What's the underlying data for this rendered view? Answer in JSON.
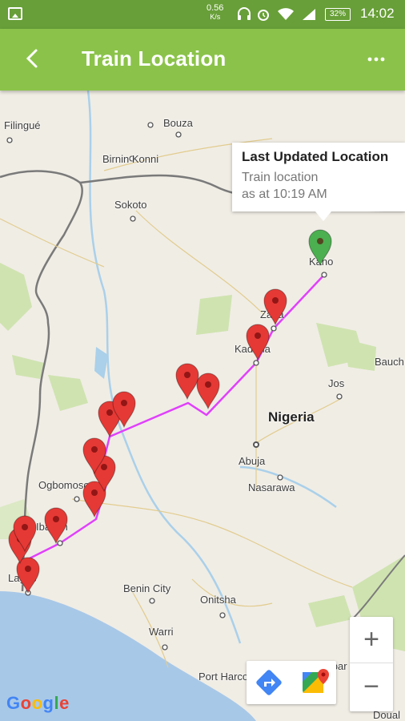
{
  "status_bar": {
    "net_speed": "0.56",
    "net_unit": "K/s",
    "battery": "32%",
    "time": "14:02"
  },
  "app_bar": {
    "title": "Train Location"
  },
  "map": {
    "places": {
      "filingue": "Filingué",
      "bouza": "Bouza",
      "birnin_konni": "Birnin Konni",
      "sokoto": "Sokoto",
      "kano": "Kano",
      "zaria": "Zaria",
      "kaduna": "Kaduna",
      "bauchi": "Bauch",
      "jos": "Jos",
      "nigeria": "Nigeria",
      "abuja": "Abuja",
      "nasarawa": "Nasarawa",
      "ogbomoso": "Ogbomoso",
      "ibadan": "Ibadan",
      "lagos": "Lagos",
      "benin_city": "Benin City",
      "onitsha": "Onitsha",
      "warri": "Warri",
      "port_harcourt": "Port Harco",
      "calabar": "Calabar",
      "douala": "Doual"
    },
    "info_window": {
      "title": "Last Updated Location",
      "line1": "Train location",
      "line2": "as at 10:19 AM"
    },
    "zoom_in": "+",
    "zoom_out": "−",
    "directions_icon": "directions-icon",
    "maps_icon": "google-maps-icon",
    "logo": "Google",
    "current_marker_color": "#4caf50",
    "history_marker_color": "#e53935",
    "route_color": "#e040fb"
  }
}
